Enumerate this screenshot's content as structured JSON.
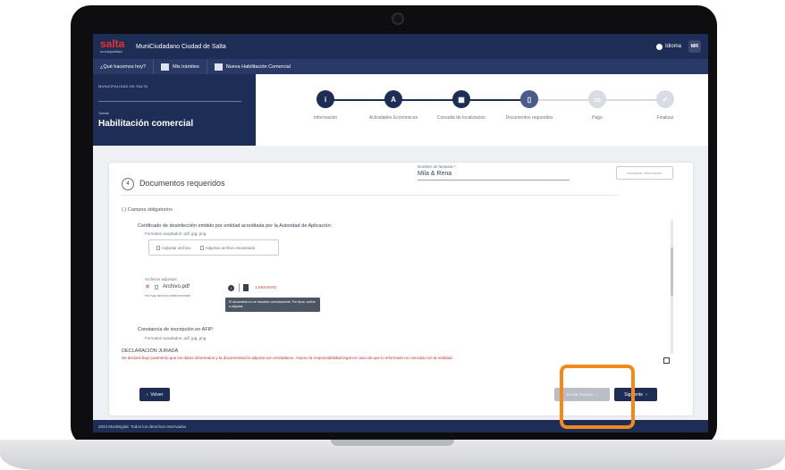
{
  "app": {
    "logo_word": "salta",
    "logo_sub": "municipalidad",
    "title": "MuniCiudadano Ciudad de Salta",
    "language": "Idioma",
    "user_initials": "MR"
  },
  "nav": {
    "items": [
      {
        "label": "¿Qué hacemos hoy?"
      },
      {
        "label": "Mis trámites"
      },
      {
        "label": "Nueva Habilitación Comercial"
      }
    ]
  },
  "header": {
    "municipality": "MUNICIPALIDAD DE SALTA",
    "tramite_label": "Trámite",
    "tramite_title": "Habilitación comercial"
  },
  "stepper": {
    "steps": [
      {
        "label": "Información",
        "icon": "i",
        "state": "done"
      },
      {
        "label": "Actividades Económicas",
        "icon": "A",
        "state": "done"
      },
      {
        "label": "Consulta de localización",
        "icon": "▦",
        "state": "done"
      },
      {
        "label": "Documentos requeridos",
        "icon": "▯",
        "state": "current"
      },
      {
        "label": "Pago",
        "icon": "▭",
        "state": "pending"
      },
      {
        "label": "Finalizar",
        "icon": "✓",
        "state": "pending"
      }
    ]
  },
  "section": {
    "number": "4",
    "title": "Documentos requeridos",
    "fantasy_label": "Nombre de fantasía *",
    "fantasy_value": "Mila & Rena",
    "update_button": "actualizar información"
  },
  "documents": {
    "optional_label": "( ) Campos obligatorios",
    "doc1_title": "Certificado de desinfección emitido por entidad acreditada por la Autoridad de Aplicación:",
    "doc1_formats": "Formatos aceptados: pdf, jpg, png",
    "upload_option_1": "Adjuntar archivo",
    "upload_option_2": "Adjuntar archivo escaneado",
    "attached_label": "Archivos adjuntos:",
    "file_name": "Archivo.pdf",
    "red_link": "1 ARCHIVO",
    "no_selected": "No hay archivo seleccionado",
    "tooltip": "El documento no se visualiza correctamente. Por favor, vuelve a adjuntar.",
    "doc2_title": "Constancia de inscripción en AFIP:",
    "doc2_formats": "Formatos aceptados: pdf, jpg, png"
  },
  "declaration": {
    "title": "DECLARACIÓN JURADA",
    "text": "Se declara bajo juramento que los datos informados y la documentación adjunta son verdaderos. Asumo la responsabilidad legal en caso de que lo informado no coincida con la realidad."
  },
  "actions": {
    "back": "Volver",
    "send": "Enviar revisión",
    "next": "Siguiente"
  },
  "footer": {
    "text": "2023 MuniDigital. Todos los derechos reservados"
  },
  "colors": {
    "navy": "#1e2d55",
    "highlight": "#f08a1c",
    "error_red": "#c53030"
  }
}
